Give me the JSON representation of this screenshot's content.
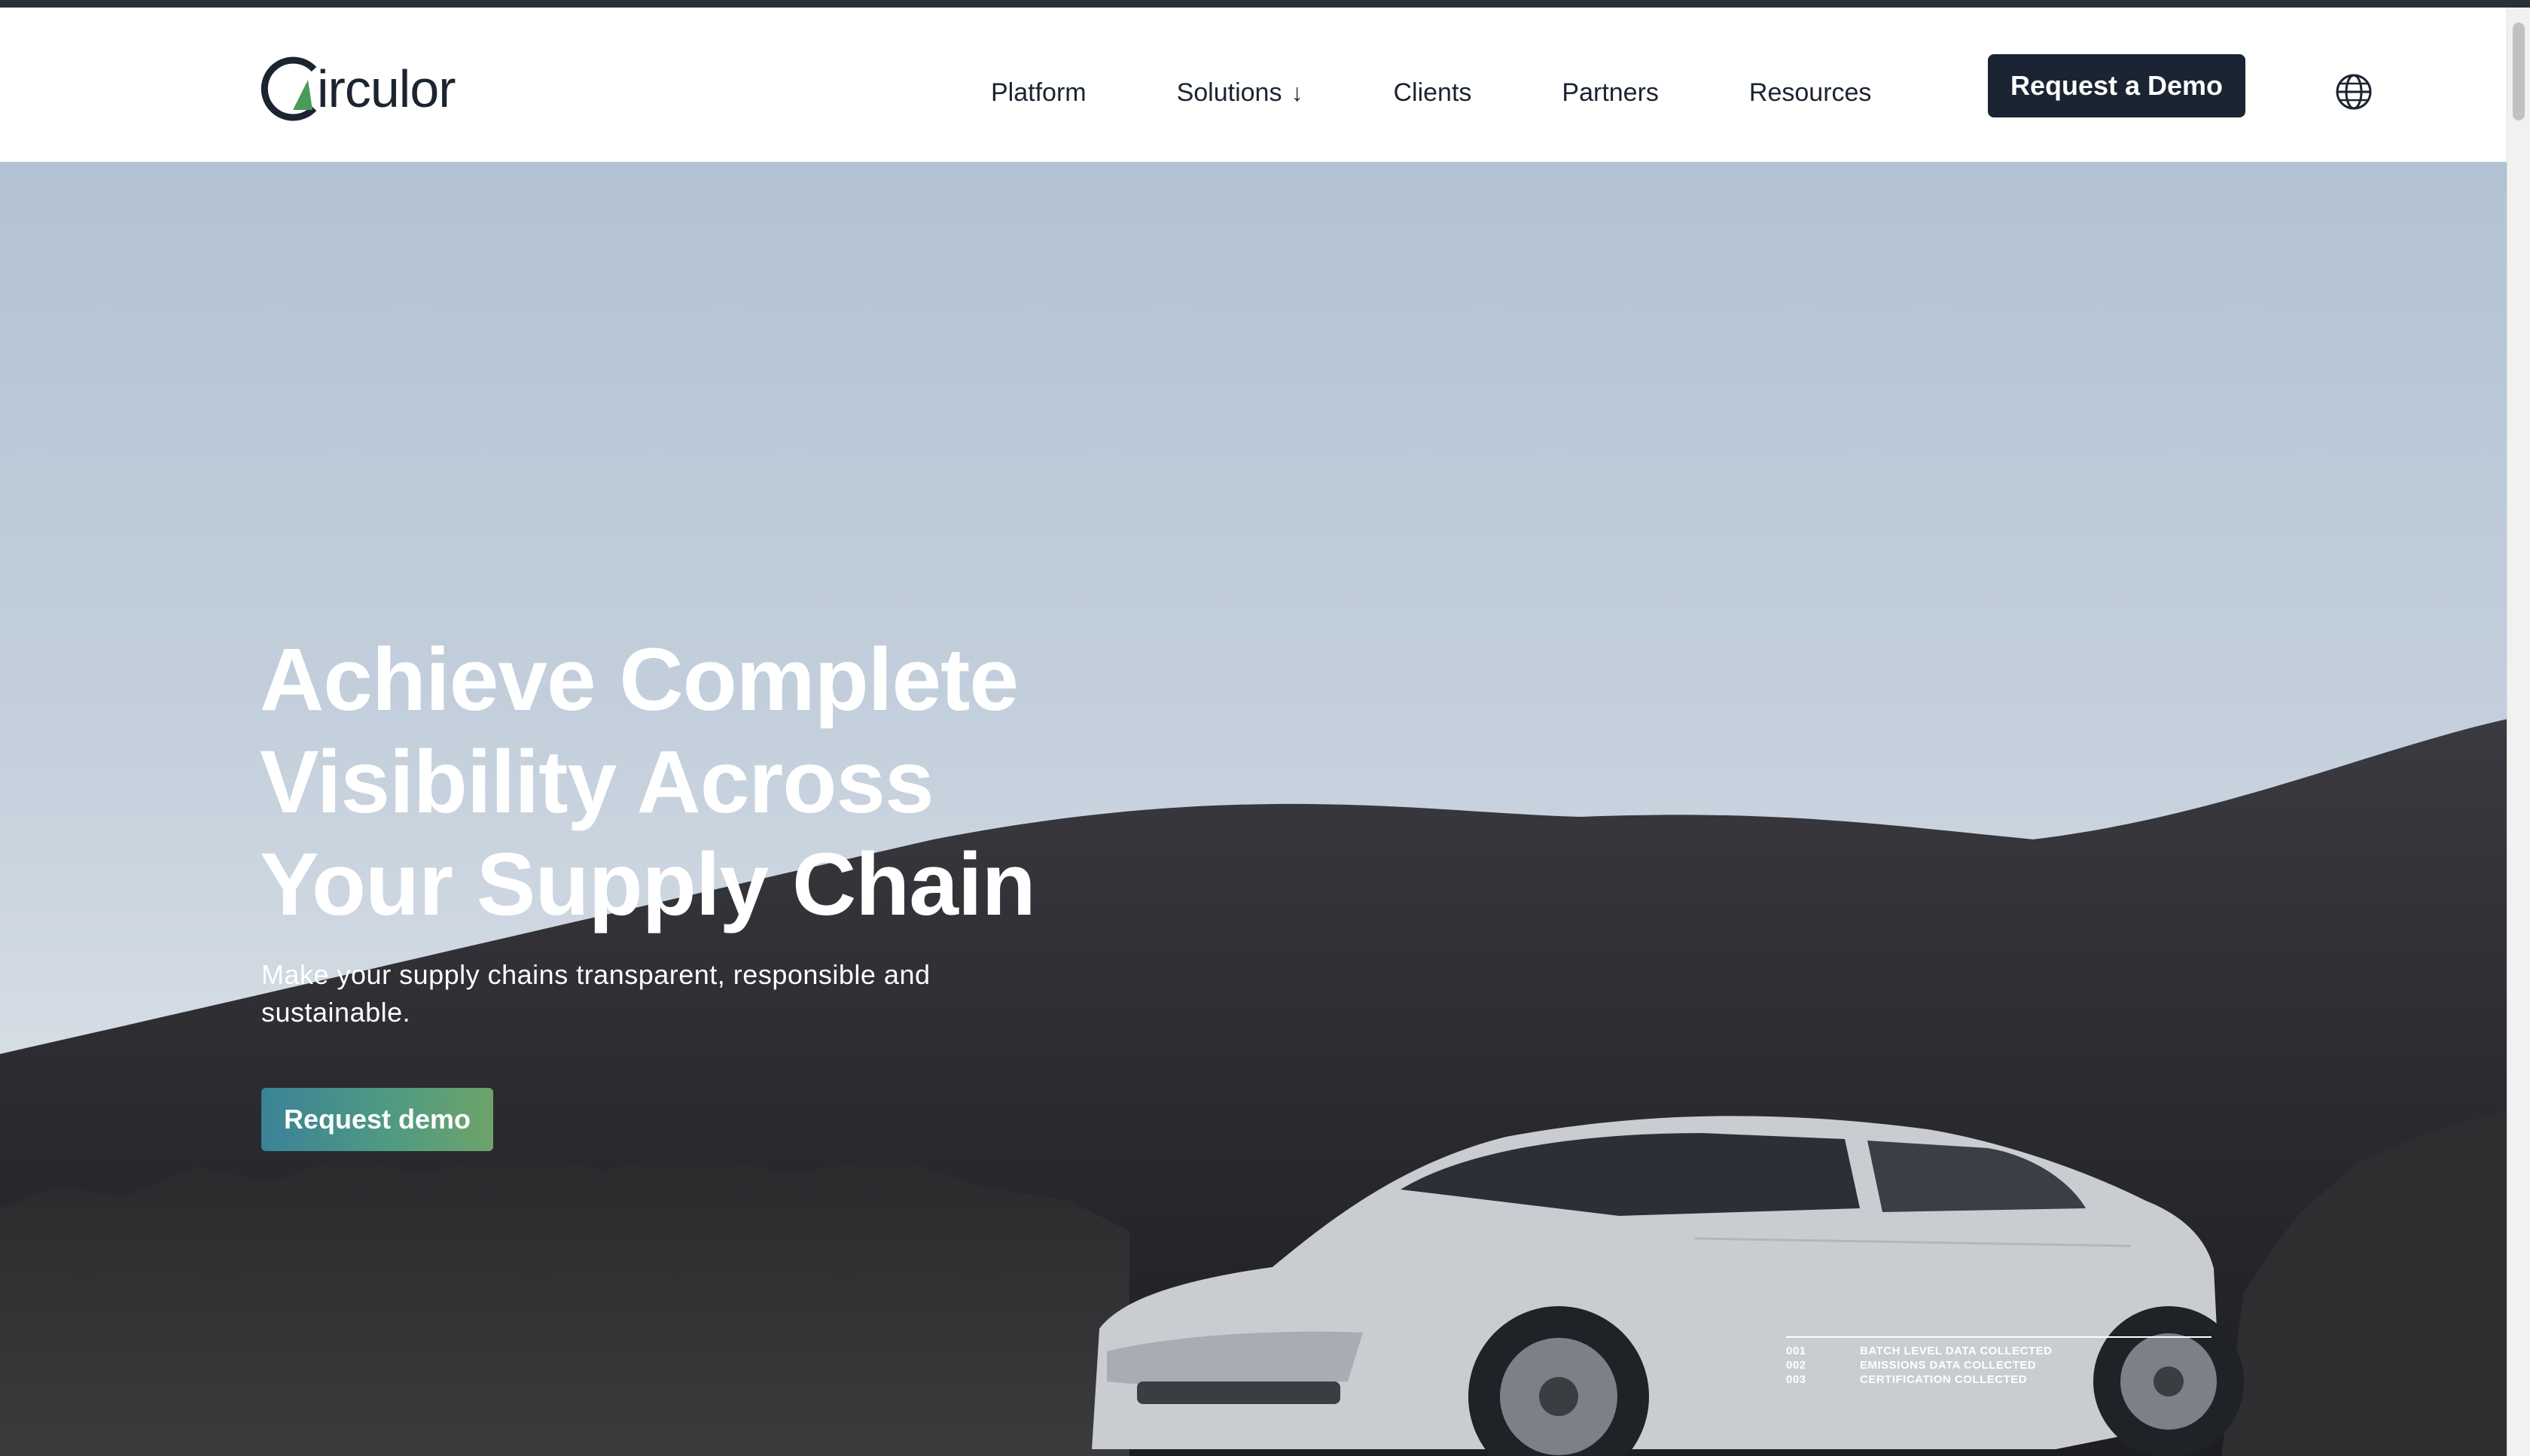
{
  "brand": {
    "name": "irculor"
  },
  "nav": {
    "items": [
      {
        "label": "Platform"
      },
      {
        "label": "Solutions",
        "icon": "arrow-down-icon",
        "arrow": "↓"
      },
      {
        "label": "Clients"
      },
      {
        "label": "Partners"
      },
      {
        "label": "Resources"
      }
    ],
    "cta": "Request a Demo",
    "language_icon": "globe-icon"
  },
  "hero": {
    "title_lines": [
      "Achieve Complete",
      "Visibility Across",
      "Your Supply Chain"
    ],
    "subtitle": "Make your supply chains transparent, responsible and sustainable.",
    "button": "Request demo"
  },
  "data_panel": {
    "rows": [
      {
        "num": "001",
        "label": "BATCH LEVEL DATA COLLECTED"
      },
      {
        "num": "002",
        "label": "EMISSIONS DATA COLLECTED"
      },
      {
        "num": "003",
        "label": "CERTIFICATION COLLECTED"
      }
    ]
  },
  "colors": {
    "nav_text": "#1b2430",
    "cta_bg": "#1a2433",
    "accent_gradient_start": "#3a8298",
    "accent_gradient_end": "#6ea36a",
    "logo_green": "#4a9a5a"
  }
}
